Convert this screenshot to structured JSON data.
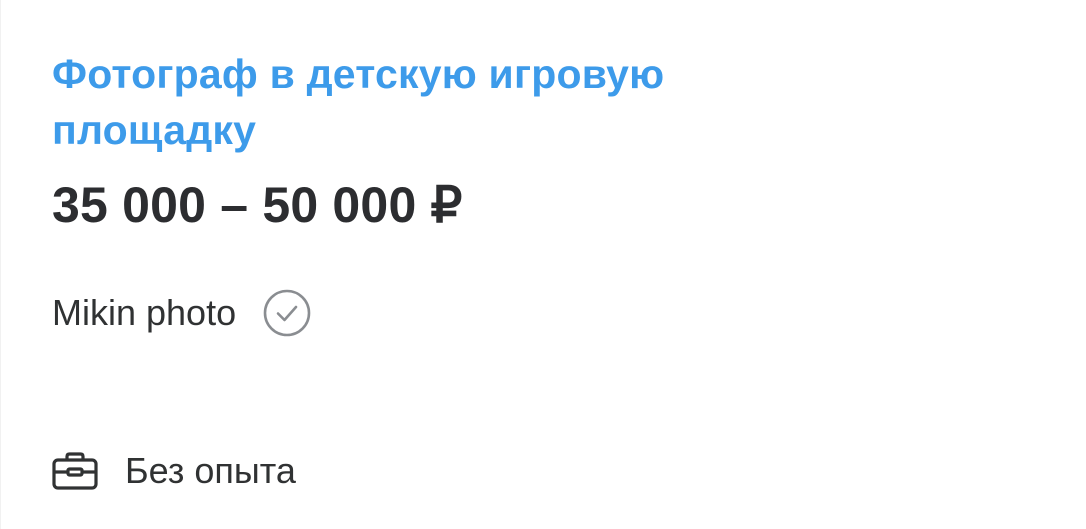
{
  "vacancy": {
    "title": "Фотограф в детскую игровую площадку",
    "salary": "35 000 – 50 000 ₽",
    "company": {
      "name": "Mikin photo",
      "verified_icon": "check-circle-icon"
    },
    "experience": {
      "icon": "briefcase-icon",
      "label": "Без опыта"
    }
  },
  "colors": {
    "title": "#3d9bea",
    "text": "#303233",
    "icon": "#8a8d91"
  }
}
